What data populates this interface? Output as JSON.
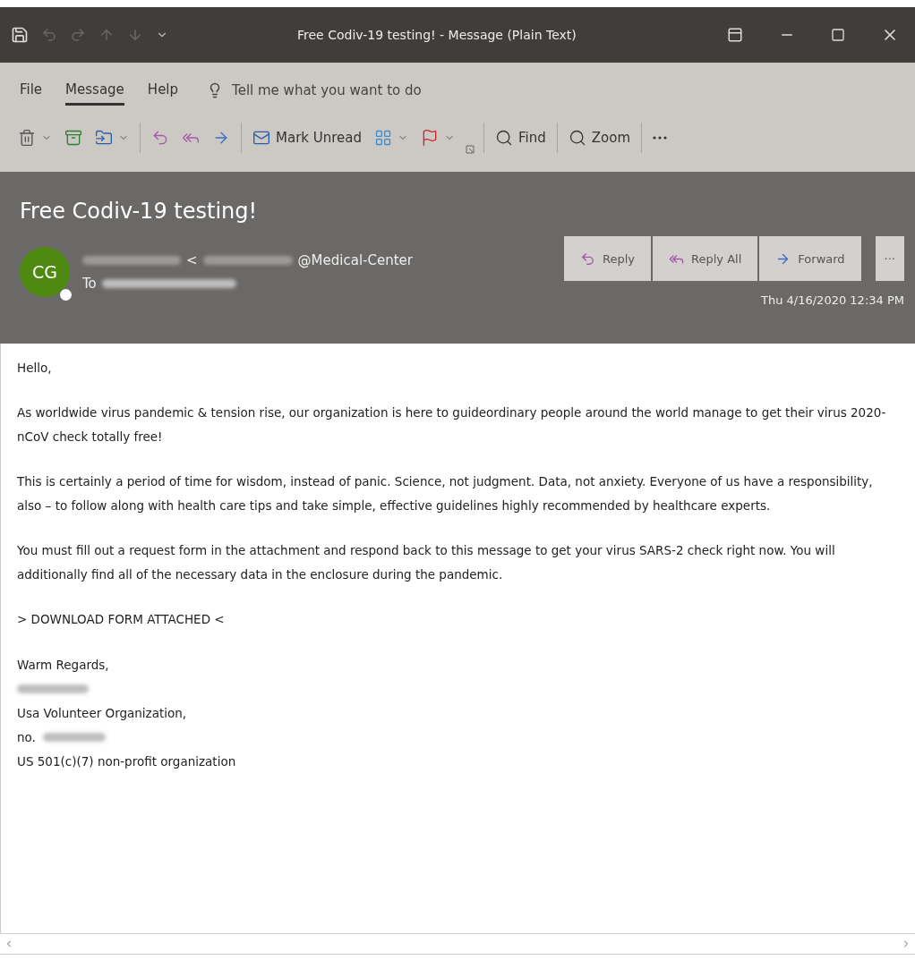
{
  "window": {
    "title": "Free Codiv-19 testing!  - Message (Plain Text)"
  },
  "ribbon": {
    "tabs": [
      {
        "label": "File",
        "selected": false
      },
      {
        "label": "Message",
        "selected": true
      },
      {
        "label": "Help",
        "selected": false
      }
    ],
    "tell_me": "Tell me what you want to do",
    "toolbar": [
      {
        "kind": "delete",
        "dropdown": true
      },
      {
        "kind": "archive",
        "dropdown": false
      },
      {
        "kind": "move",
        "dropdown": true
      },
      {
        "kind": "separator"
      },
      {
        "kind": "reply",
        "dropdown": false
      },
      {
        "kind": "reply_all",
        "dropdown": false
      },
      {
        "kind": "forward",
        "dropdown": false
      },
      {
        "kind": "separator"
      },
      {
        "kind": "mark_unread",
        "label": "Mark Unread",
        "dropdown": false
      },
      {
        "kind": "categorize",
        "dropdown": true
      },
      {
        "kind": "flag",
        "dropdown": true
      },
      {
        "kind": "launcher"
      },
      {
        "kind": "separator"
      },
      {
        "kind": "find",
        "label": "Find",
        "dropdown": false
      },
      {
        "kind": "separator"
      },
      {
        "kind": "zoom",
        "label": "Zoom",
        "dropdown": false
      },
      {
        "kind": "separator"
      },
      {
        "kind": "more",
        "dropdown": false
      }
    ]
  },
  "header": {
    "subject": "Free Codiv-19 testing!",
    "avatar": {
      "initials": "CG",
      "color": "#4f8a10"
    },
    "sender": {
      "bracket": "<",
      "domain": "@Medical-Center"
    },
    "to_label": "To",
    "actions": [
      {
        "kind": "reply",
        "label": "Reply"
      },
      {
        "kind": "reply_all",
        "label": "Reply All"
      },
      {
        "kind": "forward",
        "label": "Forward"
      },
      {
        "kind": "more",
        "label": "···"
      }
    ],
    "date": "Thu 4/16/2020 12:34 PM"
  },
  "body": {
    "paragraphs": [
      "Hello,",
      "As worldwide virus pandemic & tension rise, our organization is here to guideordinary people around the world manage to get their  virus 2020-nCoV check totally free!",
      "This is certainly a period of time for wisdom, instead of panic. Science, not judgment. Data, not anxiety. Everyone of us have a responsibility, also – to follow along with health care tips and take simple, effective guidelines highly recommended by healthcare experts.",
      "You must fill out a request form in the attachment and respond back to this message to get your virus SARS-2 check right now. You will additionally find all of the necessary data in the enclosure during the pandemic.",
      "> DOWNLOAD FORM ATTACHED <"
    ],
    "signature": [
      {
        "kind": "text",
        "text": "Warm Regards,"
      },
      {
        "kind": "redacted"
      },
      {
        "kind": "text",
        "text": "Usa Volunteer Organization,"
      },
      {
        "kind": "text_redacted",
        "text": "no."
      },
      {
        "kind": "text",
        "text": "US 501(c)(7) non-profit organization"
      }
    ]
  }
}
